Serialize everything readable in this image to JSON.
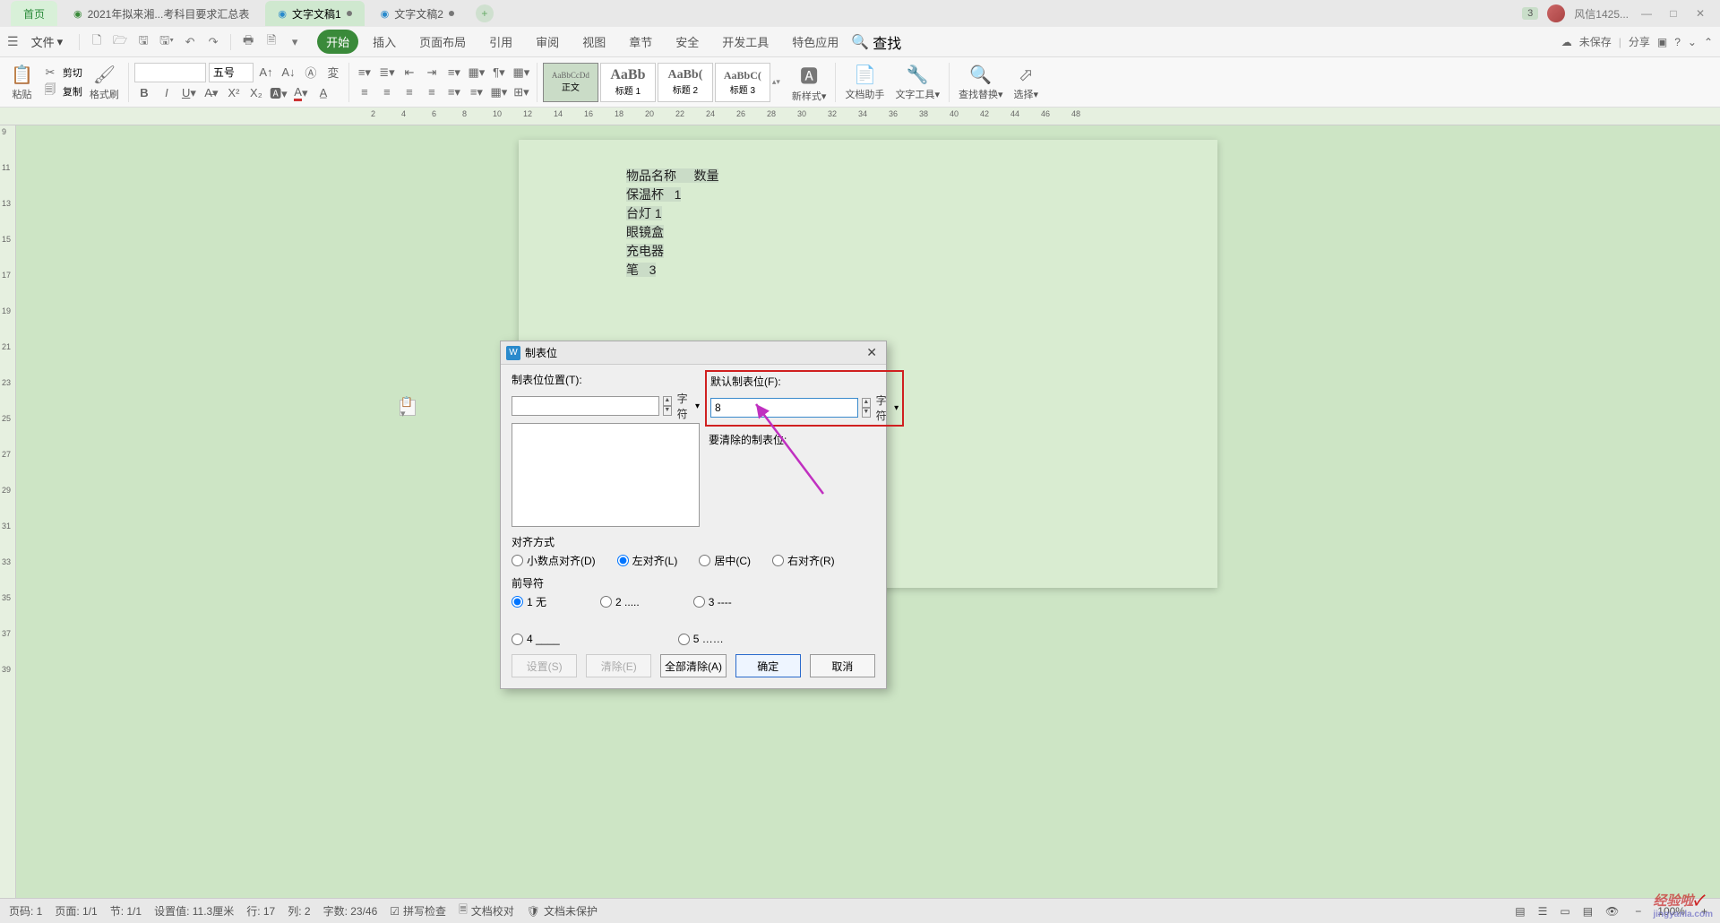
{
  "tabs": {
    "home": "首页",
    "items": [
      {
        "label": "2021年拟来湘...考科目要求汇总表",
        "icon": "S",
        "iconcolor": "#3a8a3a"
      },
      {
        "label": "文字文稿1",
        "icon": "W",
        "iconcolor": "#2a8acc",
        "active": true,
        "dirty": true
      },
      {
        "label": "文字文稿2",
        "icon": "W",
        "iconcolor": "#2a8acc",
        "dirty": true
      }
    ]
  },
  "user": {
    "name": "风信1425...",
    "badge": "3"
  },
  "menus": {
    "file": "文件",
    "items": [
      "开始",
      "插入",
      "页面布局",
      "引用",
      "审阅",
      "视图",
      "章节",
      "安全",
      "开发工具",
      "特色应用"
    ],
    "search": "查找",
    "unsaved": "未保存",
    "share": "分享"
  },
  "ribbon": {
    "paste": "粘贴",
    "cut": "剪切",
    "copy": "复制",
    "format": "格式刷",
    "fontname": "",
    "fontsize": "五号",
    "styles": [
      {
        "sample": "AaBbCcDd",
        "name": "正文",
        "sel": true
      },
      {
        "sample": "AaBb",
        "name": "标题 1"
      },
      {
        "sample": "AaBb(",
        "name": "标题 2"
      },
      {
        "sample": "AaBbC(",
        "name": "标题 3"
      }
    ],
    "newstyle": "新样式",
    "dochelper": "文档助手",
    "texttool": "文字工具",
    "findrep": "查找替换",
    "select": "选择"
  },
  "doc": {
    "rows": [
      {
        "c1": "物品名称",
        "c2": "数量"
      },
      {
        "c1": "保温杯",
        "c2": "1"
      },
      {
        "c1": "台灯",
        "c2": "1"
      },
      {
        "c1": "眼镜盒",
        "c2": ""
      },
      {
        "c1": "充电器",
        "c2": ""
      },
      {
        "c1": "笔",
        "c2": "3"
      }
    ]
  },
  "dialog": {
    "title": "制表位",
    "tabpos_label": "制表位位置(T):",
    "default_label": "默认制表位(F):",
    "default_value": "8",
    "unit": "字符",
    "clear_label": "要清除的制表位:",
    "align_group": "对齐方式",
    "aligns": [
      {
        "label": "小数点对齐(D)",
        "val": "dec"
      },
      {
        "label": "左对齐(L)",
        "val": "left",
        "checked": true
      },
      {
        "label": "居中(C)",
        "val": "center"
      },
      {
        "label": "右对齐(R)",
        "val": "right"
      }
    ],
    "leader_group": "前导符",
    "leaders": [
      {
        "label": "1 无",
        "checked": true
      },
      {
        "label": "2 ....."
      },
      {
        "label": "3 ----"
      },
      {
        "label": "4 ____"
      },
      {
        "label": "5 ……"
      }
    ],
    "buttons": {
      "set": "设置(S)",
      "clear": "清除(E)",
      "clearall": "全部清除(A)",
      "ok": "确定",
      "cancel": "取消"
    }
  },
  "status": {
    "page": "页码: 1",
    "pages": "页面: 1/1",
    "section": "节: 1/1",
    "setval": "设置值: 11.3厘米",
    "line": "行: 17",
    "col": "列: 2",
    "words": "字数: 23/46",
    "spell": "拼写检查",
    "proof": "文档校对",
    "protect": "文档未保护",
    "zoom": "100%"
  },
  "watermark": {
    "text": "经验啦",
    "url": "jingyanla.com"
  }
}
